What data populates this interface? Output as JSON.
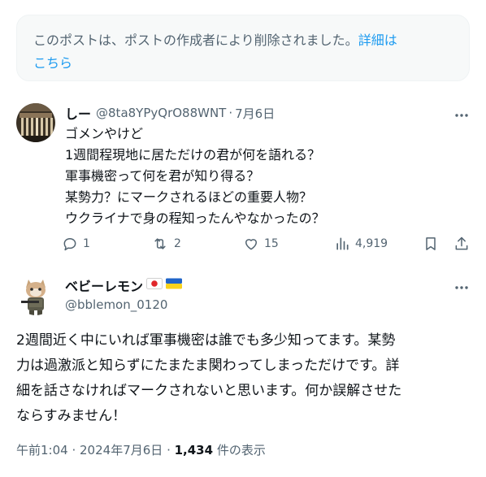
{
  "deleted_notice": {
    "line1": "このポストは、ポストの作成者により削除されました。",
    "link_part1": "詳細は",
    "link_part2": "こちら"
  },
  "reply": {
    "name": "しー",
    "handle": "@8ta8YPyQrO88WNT",
    "date": "7月6日",
    "text_lines": [
      "ゴメンやけど",
      "1週間程現地に居ただけの君が何を語れる？",
      "軍事機密って何を君が知り得る？",
      "某勢力？にマークされるほどの重要人物？",
      "ウクライナで身の程知ったんやなかったの？"
    ],
    "actions": {
      "replies": "1",
      "reposts": "2",
      "likes": "15",
      "views": "4,919"
    }
  },
  "main_post": {
    "name": "ベビーレモン",
    "handle": "@bblemon_0120",
    "text_lines": [
      "2週間近く中にいれば軍事機密は誰でも多少知ってます。某勢",
      "力は過激派と知らずにたまたま関わってしまっただけです。詳",
      "細を話さなければマークされないと思います。何か誤解させた",
      "ならすみません！"
    ],
    "time": "午前1:04",
    "date": "2024年7月6日",
    "views_count": "1,434",
    "views_label": "件の表示"
  },
  "colors": {
    "text": "#0f1419",
    "muted": "#536471",
    "link": "#1d9bf0",
    "notice_bg": "#f7f9f9"
  },
  "icons": [
    "more-icon",
    "reply-icon",
    "repost-icon",
    "like-icon",
    "views-icon",
    "bookmark-icon",
    "share-icon",
    "japan-flag-icon",
    "ukraine-flag-icon"
  ]
}
